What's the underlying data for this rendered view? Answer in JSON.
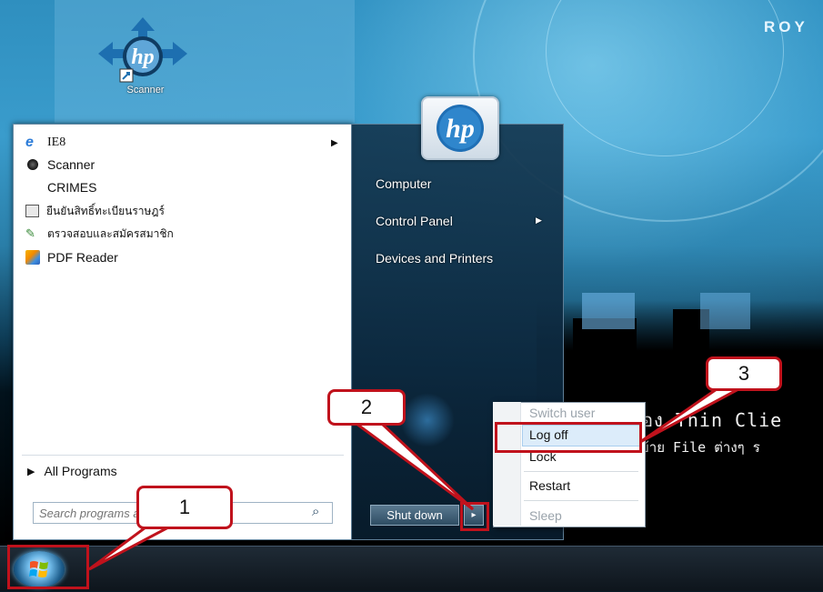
{
  "desktop": {
    "brand_text": "ROY",
    "overlay_line1": "ื่อง Thin Clie",
    "overlay_line2": "ย้าย File ต่างๆ ร",
    "scanner_icon_label": "Scanner"
  },
  "start_menu": {
    "programs": [
      {
        "label": "IE8",
        "icon": "internet-explorer-icon",
        "has_submenu": true
      },
      {
        "label": "Scanner",
        "icon": "scanner-icon",
        "has_submenu": false
      },
      {
        "label": "CRIMES",
        "icon": "",
        "has_submenu": false
      },
      {
        "label": "ยืนยันสิทธิ์ทะเบียนราษฎร์",
        "icon": "id-card-icon",
        "has_submenu": false
      },
      {
        "label": "ตรวจสอบและสมัครสมาชิก",
        "icon": "member-check-icon",
        "has_submenu": false
      },
      {
        "label": "PDF Reader",
        "icon": "pdf-reader-icon",
        "has_submenu": false
      }
    ],
    "all_programs_label": "All Programs",
    "search_placeholder": "Search programs and files",
    "right_links": [
      {
        "label": "Computer",
        "has_submenu": false
      },
      {
        "label": "Control Panel",
        "has_submenu": true
      },
      {
        "label": "Devices and Printers",
        "has_submenu": false
      }
    ],
    "shutdown_label": "Shut down",
    "shutdown_arrow": "▸"
  },
  "power_menu": {
    "items": [
      {
        "label": "Switch user",
        "enabled": false
      },
      {
        "label": "Log off",
        "enabled": true
      },
      {
        "label": "Lock",
        "enabled": true
      },
      {
        "label": "Restart",
        "enabled": true
      },
      {
        "label": "Sleep",
        "enabled": false
      }
    ]
  },
  "annotations": {
    "callout_1": "1",
    "callout_2": "2",
    "callout_3": "3",
    "color": "#c0121c"
  }
}
